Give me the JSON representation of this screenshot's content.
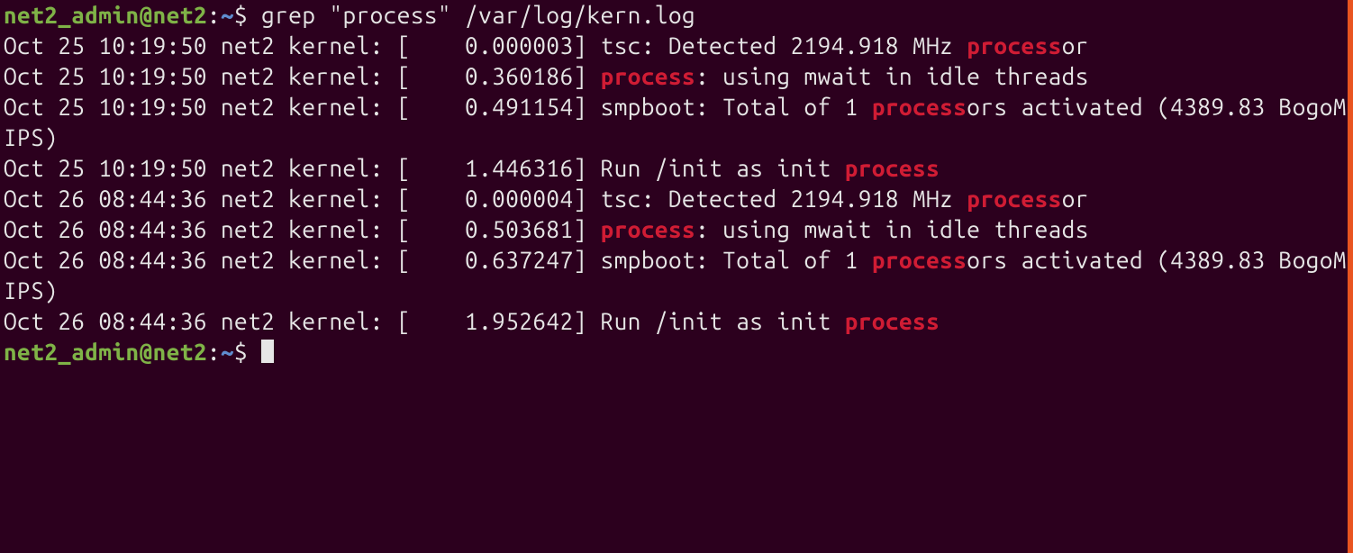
{
  "colors": {
    "background": "#2c001e",
    "text": "#e6e6e6",
    "prompt_user": "#7fb347",
    "prompt_path": "#5f8dcf",
    "match": "#d01c34",
    "accent_edge": "#e95420"
  },
  "prompt": {
    "user_host": "net2_admin@net2",
    "separator": ":",
    "path": "~",
    "symbol": "$"
  },
  "command": "grep \"process\" /var/log/kern.log",
  "match_word": "process",
  "output_lines": [
    {
      "prefix": "Oct 25 10:19:50 net2 kernel: [    0.000003] tsc: Detected 2194.918 MHz ",
      "match": "process",
      "suffix": "or"
    },
    {
      "prefix": "Oct 25 10:19:50 net2 kernel: [    0.360186] ",
      "match": "process",
      "suffix": ": using mwait in idle threads"
    },
    {
      "prefix": "Oct 25 10:19:50 net2 kernel: [    0.491154] smpboot: Total of 1 ",
      "match": "process",
      "suffix": "ors activated (4389.83 BogoMIPS)"
    },
    {
      "prefix": "Oct 25 10:19:50 net2 kernel: [    1.446316] Run /init as init ",
      "match": "process",
      "suffix": ""
    },
    {
      "prefix": "Oct 26 08:44:36 net2 kernel: [    0.000004] tsc: Detected 2194.918 MHz ",
      "match": "process",
      "suffix": "or"
    },
    {
      "prefix": "Oct 26 08:44:36 net2 kernel: [    0.503681] ",
      "match": "process",
      "suffix": ": using mwait in idle threads"
    },
    {
      "prefix": "Oct 26 08:44:36 net2 kernel: [    0.637247] smpboot: Total of 1 ",
      "match": "process",
      "suffix": "ors activated (4389.83 BogoMIPS)"
    },
    {
      "prefix": "Oct 26 08:44:36 net2 kernel: [    1.952642] Run /init as init ",
      "match": "process",
      "suffix": ""
    }
  ]
}
